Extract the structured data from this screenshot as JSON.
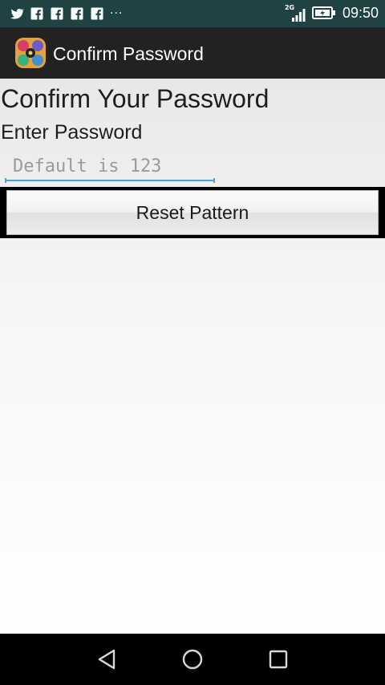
{
  "status_bar": {
    "notification_icons": [
      "twitter-icon",
      "facebook-icon",
      "facebook-icon",
      "facebook-icon",
      "facebook-icon"
    ],
    "overflow": "···",
    "network_type": "2G",
    "time": "09:50"
  },
  "action_bar": {
    "title": "Confirm Password"
  },
  "main": {
    "heading": "Confirm Your Password",
    "field_label": "Enter Password",
    "password_placeholder": "Default is 123",
    "password_value": "",
    "reset_button_label": "Reset Pattern"
  },
  "nav_bar": {
    "back_icon": "back-triangle-icon",
    "home_icon": "home-circle-icon",
    "recent_icon": "recent-square-icon"
  },
  "colors": {
    "status_bar": "#1f4244",
    "action_bar": "#222222",
    "field_underline": "#5a9ec8",
    "nav_bar": "#000000"
  }
}
